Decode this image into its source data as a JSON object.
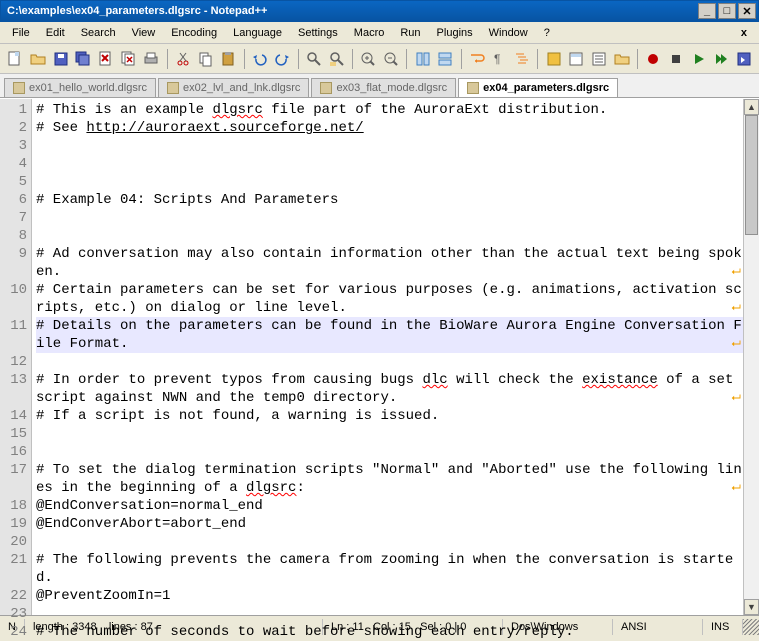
{
  "window": {
    "title": "C:\\examples\\ex04_parameters.dlgsrc - Notepad++"
  },
  "menu": {
    "items": [
      "File",
      "Edit",
      "Search",
      "View",
      "Encoding",
      "Language",
      "Settings",
      "Macro",
      "Run",
      "Plugins",
      "Window",
      "?"
    ]
  },
  "tabs": {
    "items": [
      {
        "label": "ex01_hello_world.dlgsrc",
        "active": false
      },
      {
        "label": "ex02_lvl_and_lnk.dlgsrc",
        "active": false
      },
      {
        "label": "ex03_flat_mode.dlgsrc",
        "active": false
      },
      {
        "label": "ex04_parameters.dlgsrc",
        "active": true
      }
    ]
  },
  "editor": {
    "lines": [
      {
        "n": 1,
        "text": "# This is an example dlgsrc file part of the AuroraExt distribution.",
        "wrap": false,
        "spell": [
          "dlgsrc"
        ]
      },
      {
        "n": 2,
        "text": "# See http://auroraext.sourceforge.net/",
        "wrap": false,
        "link": "http://auroraext.sourceforge.net/"
      },
      {
        "n": 3,
        "text": "",
        "wrap": false
      },
      {
        "n": 4,
        "text": "",
        "wrap": false
      },
      {
        "n": 5,
        "text": "",
        "wrap": false
      },
      {
        "n": 6,
        "text": "# Example 04: Scripts And Parameters",
        "wrap": false
      },
      {
        "n": 7,
        "text": "",
        "wrap": false
      },
      {
        "n": 8,
        "text": "",
        "wrap": false
      },
      {
        "n": 9,
        "text": "# Ad conversation may also contain information other than the actual text being spoken.",
        "wrap": true
      },
      {
        "n": 10,
        "text": "# Certain parameters can be set for various purposes (e.g. animations, activation scripts, etc.) on dialog or line level.",
        "wrap": true
      },
      {
        "n": 11,
        "text": "# Details on the parameters can be found in the BioWare Aurora Engine Conversation File Format.",
        "wrap": true,
        "current": true
      },
      {
        "n": 12,
        "text": "",
        "wrap": false
      },
      {
        "n": 13,
        "text": "# In order to prevent typos from causing bugs dlc will check the existance of a set script against NWN and the temp0 directory.",
        "wrap": true,
        "spell": [
          "dlc",
          "existance"
        ]
      },
      {
        "n": 14,
        "text": "# If a script is not found, a warning is issued.",
        "wrap": false
      },
      {
        "n": 15,
        "text": "",
        "wrap": false
      },
      {
        "n": 16,
        "text": "",
        "wrap": false
      },
      {
        "n": 17,
        "text": "# To set the dialog termination scripts \"Normal\" and \"Aborted\" use the following lines in the beginning of a dlgsrc:",
        "wrap": true,
        "spell": [
          "dlgsrc"
        ]
      },
      {
        "n": 18,
        "text": "@EndConversation=normal_end",
        "wrap": false
      },
      {
        "n": 19,
        "text": "@EndConverAbort=abort_end",
        "wrap": false
      },
      {
        "n": 20,
        "text": "",
        "wrap": false
      },
      {
        "n": 21,
        "text": "# The following prevents the camera from zooming in when the conversation is started.",
        "wrap": false
      },
      {
        "n": 22,
        "text": "@PreventZoomIn=1",
        "wrap": false
      },
      {
        "n": 23,
        "text": "",
        "wrap": false
      },
      {
        "n": 24,
        "text": "# The number of seconds to wait before showing each entry/reply.",
        "wrap": false
      }
    ]
  },
  "status": {
    "npp_prefix": "N",
    "length_label": "length : ",
    "length": "3348",
    "lines_label": "lines : ",
    "lines": "87",
    "ln_label": "Ln : ",
    "ln": "11",
    "col_label": "Col : ",
    "col": "15",
    "sel_label": "Sel : ",
    "sel": "0 | 0",
    "eol": "Dos\\Windows",
    "encoding": "ANSI",
    "mode": "INS"
  },
  "colors": {
    "accent": "#316ac5"
  }
}
